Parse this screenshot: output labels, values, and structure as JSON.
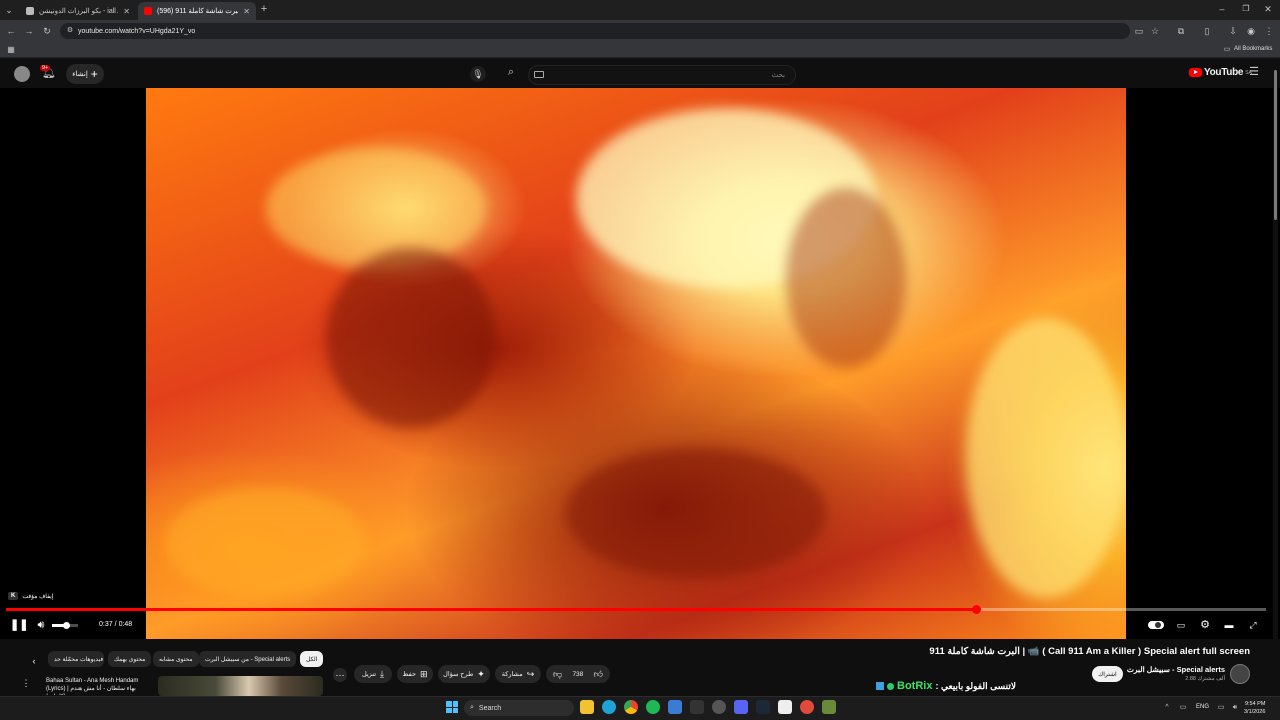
{
  "browser": {
    "tabs": [
      {
        "title": "بكو البرزات الدونيشن - iall Alert",
        "active": false
      },
      {
        "title": "(596) البرت شاشة كاملة 911",
        "active": true
      }
    ],
    "url": "youtube.com/watch?v=UHgda21Y_vo",
    "bookmarks_label": "All Bookmarks"
  },
  "youtube": {
    "logo_text": "YouTube",
    "logo_region": "SA",
    "search_placeholder": "بحث",
    "create_label": "إنشاء",
    "notifications_count": "9+"
  },
  "player": {
    "time_current": "0:37",
    "time_separator": "/",
    "time_total": "0:48",
    "progress_fraction": 0.77,
    "volume_fraction": 0.55,
    "tooltip_key": "K",
    "tooltip_text": "إيقاف مؤقت"
  },
  "video_info": {
    "title": "البرت شاشة كاملة 911 | 📹 ( Call 911 Am a Killer ) Special alert full screen",
    "channel": "سبيشل البرت - Special alerts",
    "subscribers": "2.88 ألف مشترك",
    "subscribe_label": "اشتراك",
    "likes": "738",
    "share_label": "مشاركة",
    "remix_label": "طرح سؤال",
    "save_label": "حفظ",
    "download_label": "تنزيل",
    "chat_user": "BotRix",
    "chat_message": ": لاتنسى الفولو بابيعي"
  },
  "chips": [
    {
      "label": "الكل",
      "selected": true
    },
    {
      "label": "من سبيشل البرت - Special alerts",
      "selected": false
    },
    {
      "label": "محتوى مشابه",
      "selected": false
    },
    {
      "label": "محتوى يهمك",
      "selected": false
    },
    {
      "label": "فيديوهات محمّلة حد",
      "selected": false
    }
  ],
  "up_next": {
    "title": "Bahaa Sultan - Ana Mesh Handam (Lyrics) | بهاء سلطان - أنا مش هندم (كلمات)"
  },
  "taskbar": {
    "search_label": "Search",
    "lang": "ENG",
    "time": "9:54 PM",
    "date": "3/1/2026"
  },
  "colors": {
    "accent": "#ff0000",
    "background": "#0f0f0f",
    "chip": "#272727"
  }
}
